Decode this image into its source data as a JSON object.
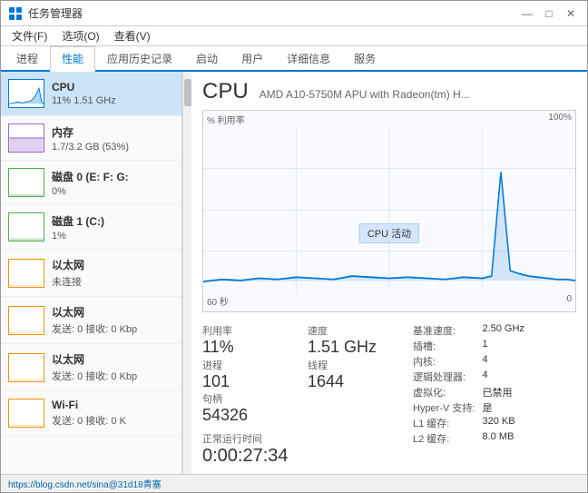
{
  "window": {
    "title": "任务管理器",
    "controls": {
      "minimize": "—",
      "maximize": "□",
      "close": "✕"
    }
  },
  "menu": {
    "items": [
      "文件(F)",
      "选项(O)",
      "查看(V)"
    ]
  },
  "tabs": [
    {
      "label": "进程"
    },
    {
      "label": "性能",
      "active": true
    },
    {
      "label": "应用历史记录"
    },
    {
      "label": "启动"
    },
    {
      "label": "用户"
    },
    {
      "label": "详细信息"
    },
    {
      "label": "服务"
    }
  ],
  "sidebar": {
    "items": [
      {
        "name": "CPU",
        "value": "11% 1.51 GHz",
        "type": "cpu",
        "active": true
      },
      {
        "name": "内存",
        "value": "1.7/3.2 GB (53%)",
        "type": "mem"
      },
      {
        "name": "磁盘 0 (E: F: G:",
        "value": "0%",
        "type": "disk"
      },
      {
        "name": "磁盘 1 (C:)",
        "value": "1%",
        "type": "disk"
      },
      {
        "name": "以太网",
        "value": "未连接",
        "type": "eth"
      },
      {
        "name": "以太网",
        "value": "发送: 0 接收: 0 Kbp",
        "type": "eth"
      },
      {
        "name": "以太网",
        "value": "发送: 0 接收: 0 Kbp",
        "type": "eth"
      },
      {
        "name": "Wi-Fi",
        "value": "发送: 0 接收: 0 K",
        "type": "wifi"
      }
    ]
  },
  "content": {
    "title": "CPU",
    "subtitle": "AMD A10-5750M APU with Radeon(tm) H...",
    "chart": {
      "y_label": "% 利用率",
      "y_max": "100%",
      "x_start": "60 秒",
      "x_end": "0",
      "center_label": "CPU 活动"
    },
    "stats": {
      "utilization_label": "利用率",
      "utilization_value": "11%",
      "speed_label": "速度",
      "speed_value": "1.51 GHz",
      "processes_label": "进程",
      "processes_value": "101",
      "threads_label": "线程",
      "threads_value": "1644",
      "handles_label": "句柄",
      "handles_value": "54326",
      "uptime_label": "正常运行时间",
      "uptime_value": "0:00:27:34"
    },
    "right_stats": [
      {
        "label": "基准速度:",
        "value": "2.50 GHz"
      },
      {
        "label": "插槽:",
        "value": "1"
      },
      {
        "label": "内核:",
        "value": "4"
      },
      {
        "label": "逻辑处理器:",
        "value": "4"
      },
      {
        "label": "虚拟化:",
        "value": "已禁用"
      },
      {
        "label": "Hyper-V 支持:",
        "value": "是"
      },
      {
        "label": "L1 缓存:",
        "value": "320 KB"
      },
      {
        "label": "L2 缓存:",
        "value": "8.0 MB"
      }
    ]
  },
  "status_bar": {
    "text": "https://blog.csdn.net/sina@31d18青塞"
  }
}
